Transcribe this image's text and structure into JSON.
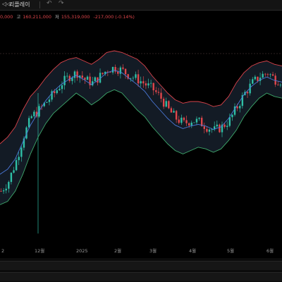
{
  "toolbar": {
    "replay_icon": "replay-icon",
    "replay_glyph": "◁◁",
    "replay_label": "리플레이",
    "undo_icon": "undo-icon",
    "undo_glyph": "↶",
    "redo_icon": "redo-icon",
    "redo_glyph": "↷"
  },
  "legend": {
    "open_value": "0,000",
    "high_label": "고",
    "high_value": "160,211,000",
    "low_label": "저",
    "low_value": "155,319,000",
    "change": "-217,000 (-0.14%)"
  },
  "colors": {
    "up": "#2fbfa6",
    "down": "#e0464b",
    "band_upper": "#d9434b",
    "band_lower": "#3fa96d",
    "mid": "#4a78d8",
    "band_fill": "#16202c",
    "grid": "#171717"
  },
  "chart_data": {
    "type": "candlestick",
    "title": "",
    "xlabel": "",
    "ylabel": "",
    "ylim": [
      0,
      100
    ],
    "grid": false,
    "legend": "top-left",
    "x_ticks": [
      "2",
      "12월",
      "2025",
      "2월",
      "3월",
      "4월",
      "5월",
      "6월"
    ],
    "indicators": [
      "Bollinger Bands"
    ],
    "close_path": [
      [
        0,
        12
      ],
      [
        3,
        18
      ],
      [
        6,
        30
      ],
      [
        9,
        45
      ],
      [
        12,
        56
      ],
      [
        15,
        60
      ],
      [
        18,
        65
      ],
      [
        21,
        70
      ],
      [
        24,
        76
      ],
      [
        27,
        80
      ],
      [
        30,
        82
      ],
      [
        33,
        78
      ],
      [
        36,
        76
      ],
      [
        39,
        80
      ],
      [
        42,
        84
      ],
      [
        45,
        85
      ],
      [
        48,
        83
      ],
      [
        51,
        80
      ],
      [
        54,
        78
      ],
      [
        57,
        75
      ],
      [
        60,
        72
      ],
      [
        63,
        67
      ],
      [
        66,
        60
      ],
      [
        69,
        55
      ],
      [
        72,
        52
      ],
      [
        75,
        54
      ],
      [
        78,
        53
      ],
      [
        81,
        50
      ],
      [
        84,
        48
      ],
      [
        87,
        50
      ],
      [
        90,
        54
      ],
      [
        93,
        62
      ],
      [
        96,
        70
      ],
      [
        99,
        76
      ],
      [
        102,
        80
      ],
      [
        105,
        82
      ],
      [
        108,
        78
      ],
      [
        111,
        77
      ]
    ],
    "bollinger_upper": [
      [
        0,
        40
      ],
      [
        3,
        44
      ],
      [
        6,
        50
      ],
      [
        9,
        60
      ],
      [
        12,
        68
      ],
      [
        15,
        73
      ],
      [
        18,
        79
      ],
      [
        21,
        84
      ],
      [
        24,
        88
      ],
      [
        27,
        90
      ],
      [
        30,
        91
      ],
      [
        33,
        89
      ],
      [
        36,
        87
      ],
      [
        39,
        90
      ],
      [
        42,
        94
      ],
      [
        45,
        95
      ],
      [
        48,
        94
      ],
      [
        51,
        92
      ],
      [
        54,
        90
      ],
      [
        57,
        86
      ],
      [
        60,
        80
      ],
      [
        63,
        75
      ],
      [
        66,
        70
      ],
      [
        69,
        66
      ],
      [
        72,
        64
      ],
      [
        75,
        65
      ],
      [
        78,
        65
      ],
      [
        81,
        64
      ],
      [
        84,
        62
      ],
      [
        87,
        63
      ],
      [
        90,
        68
      ],
      [
        93,
        76
      ],
      [
        96,
        82
      ],
      [
        99,
        86
      ],
      [
        102,
        88
      ],
      [
        105,
        89
      ],
      [
        108,
        87
      ],
      [
        111,
        86
      ]
    ],
    "bollinger_lower": [
      [
        0,
        4
      ],
      [
        3,
        6
      ],
      [
        6,
        12
      ],
      [
        9,
        22
      ],
      [
        12,
        34
      ],
      [
        15,
        44
      ],
      [
        18,
        52
      ],
      [
        21,
        58
      ],
      [
        24,
        62
      ],
      [
        27,
        66
      ],
      [
        30,
        70
      ],
      [
        33,
        67
      ],
      [
        36,
        63
      ],
      [
        39,
        66
      ],
      [
        42,
        70
      ],
      [
        45,
        72
      ],
      [
        48,
        70
      ],
      [
        51,
        65
      ],
      [
        54,
        60
      ],
      [
        57,
        56
      ],
      [
        60,
        50
      ],
      [
        63,
        45
      ],
      [
        66,
        40
      ],
      [
        69,
        36
      ],
      [
        72,
        34
      ],
      [
        75,
        36
      ],
      [
        78,
        38
      ],
      [
        81,
        37
      ],
      [
        84,
        35
      ],
      [
        87,
        37
      ],
      [
        90,
        42
      ],
      [
        93,
        48
      ],
      [
        96,
        56
      ],
      [
        99,
        62
      ],
      [
        102,
        67
      ],
      [
        105,
        70
      ],
      [
        108,
        68
      ],
      [
        111,
        67
      ]
    ]
  }
}
